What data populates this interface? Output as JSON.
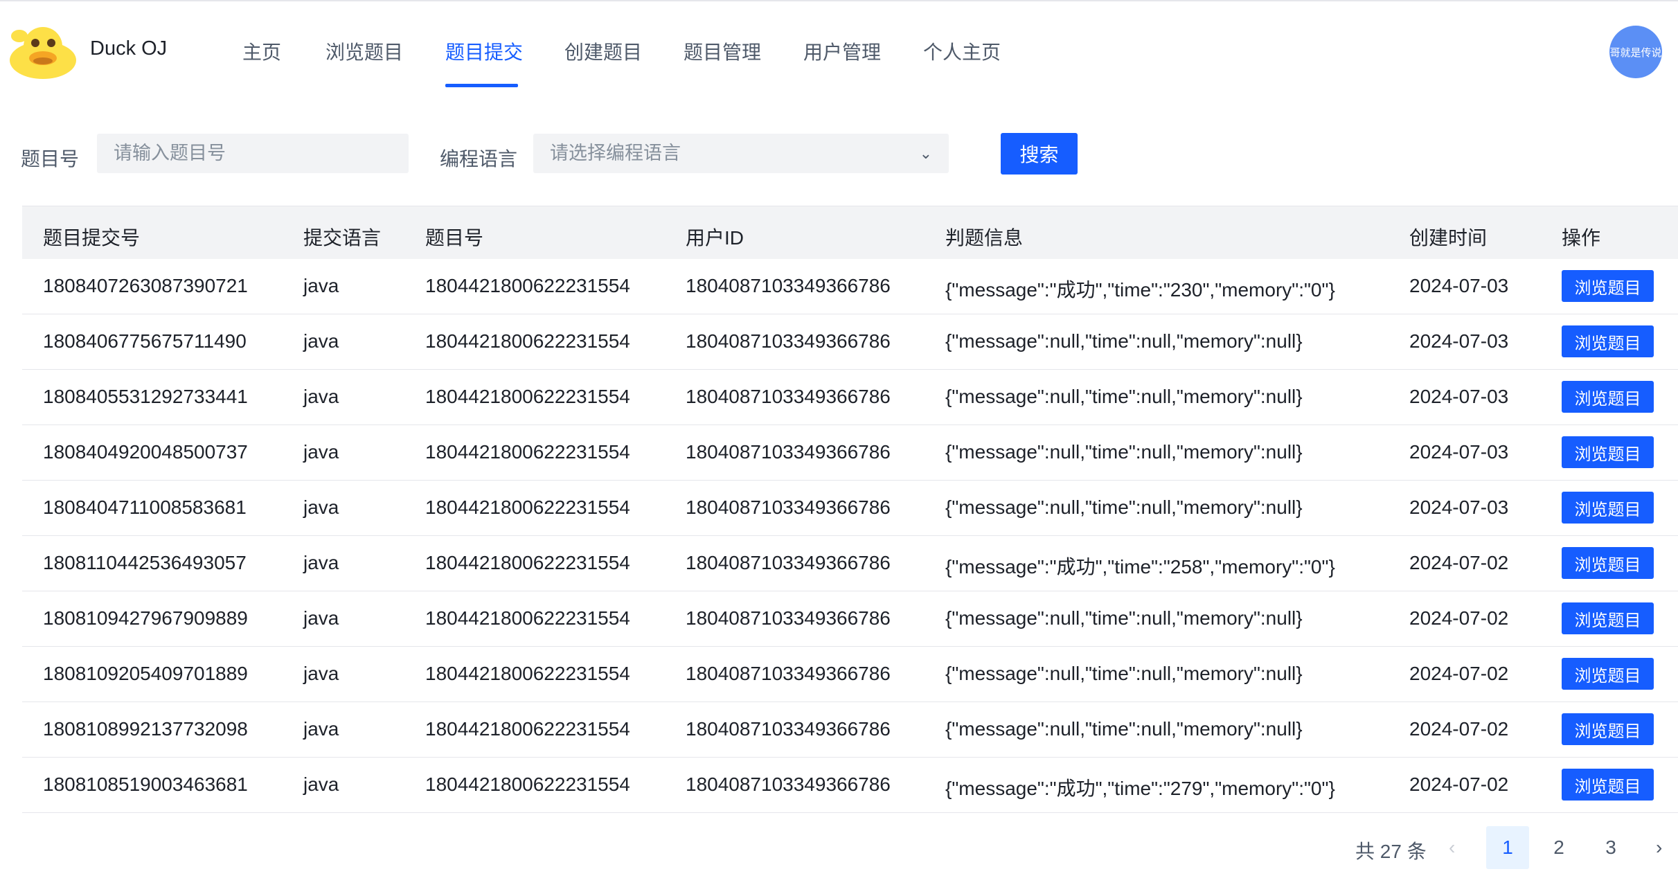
{
  "header": {
    "app_title": "Duck OJ",
    "nav": [
      "主页",
      "浏览题目",
      "题目提交",
      "创建题目",
      "题目管理",
      "用户管理",
      "个人主页"
    ],
    "active_index": 2,
    "avatar_text": "哥就是传说"
  },
  "filters": {
    "problem_id_label": "题目号",
    "problem_id_placeholder": "请输入题目号",
    "language_label": "编程语言",
    "language_placeholder": "请选择编程语言",
    "search_label": "搜索"
  },
  "table": {
    "columns": [
      "题目提交号",
      "提交语言",
      "题目号",
      "用户ID",
      "判题信息",
      "创建时间",
      "操作"
    ],
    "action_label": "浏览题目",
    "rows": [
      [
        "1808407263087390721",
        "java",
        "1804421800622231554",
        "1804087103349366786",
        "{\"message\":\"成功\",\"time\":\"230\",\"memory\":\"0\"}",
        "2024-07-03"
      ],
      [
        "1808406775675711490",
        "java",
        "1804421800622231554",
        "1804087103349366786",
        "{\"message\":null,\"time\":null,\"memory\":null}",
        "2024-07-03"
      ],
      [
        "1808405531292733441",
        "java",
        "1804421800622231554",
        "1804087103349366786",
        "{\"message\":null,\"time\":null,\"memory\":null}",
        "2024-07-03"
      ],
      [
        "1808404920048500737",
        "java",
        "1804421800622231554",
        "1804087103349366786",
        "{\"message\":null,\"time\":null,\"memory\":null}",
        "2024-07-03"
      ],
      [
        "1808404711008583681",
        "java",
        "1804421800622231554",
        "1804087103349366786",
        "{\"message\":null,\"time\":null,\"memory\":null}",
        "2024-07-03"
      ],
      [
        "1808110442536493057",
        "java",
        "1804421800622231554",
        "1804087103349366786",
        "{\"message\":\"成功\",\"time\":\"258\",\"memory\":\"0\"}",
        "2024-07-02"
      ],
      [
        "1808109427967909889",
        "java",
        "1804421800622231554",
        "1804087103349366786",
        "{\"message\":null,\"time\":null,\"memory\":null}",
        "2024-07-02"
      ],
      [
        "1808109205409701889",
        "java",
        "1804421800622231554",
        "1804087103349366786",
        "{\"message\":null,\"time\":null,\"memory\":null}",
        "2024-07-02"
      ],
      [
        "1808108992137732098",
        "java",
        "1804421800622231554",
        "1804087103349366786",
        "{\"message\":null,\"time\":null,\"memory\":null}",
        "2024-07-02"
      ],
      [
        "1808108519003463681",
        "java",
        "1804421800622231554",
        "1804087103349366786",
        "{\"message\":\"成功\",\"time\":\"279\",\"memory\":\"0\"}",
        "2024-07-02"
      ]
    ]
  },
  "pagination": {
    "total_text": "共 27 条",
    "pages": [
      "1",
      "2",
      "3"
    ],
    "current": "1",
    "prev_icon": "chevron-left-icon",
    "next_icon": "chevron-right-icon"
  },
  "colors": {
    "primary": "#165dff",
    "avatar": "#5b8ff5",
    "logo_yellow": "#fde047",
    "logo_beak": "#f5a524"
  }
}
